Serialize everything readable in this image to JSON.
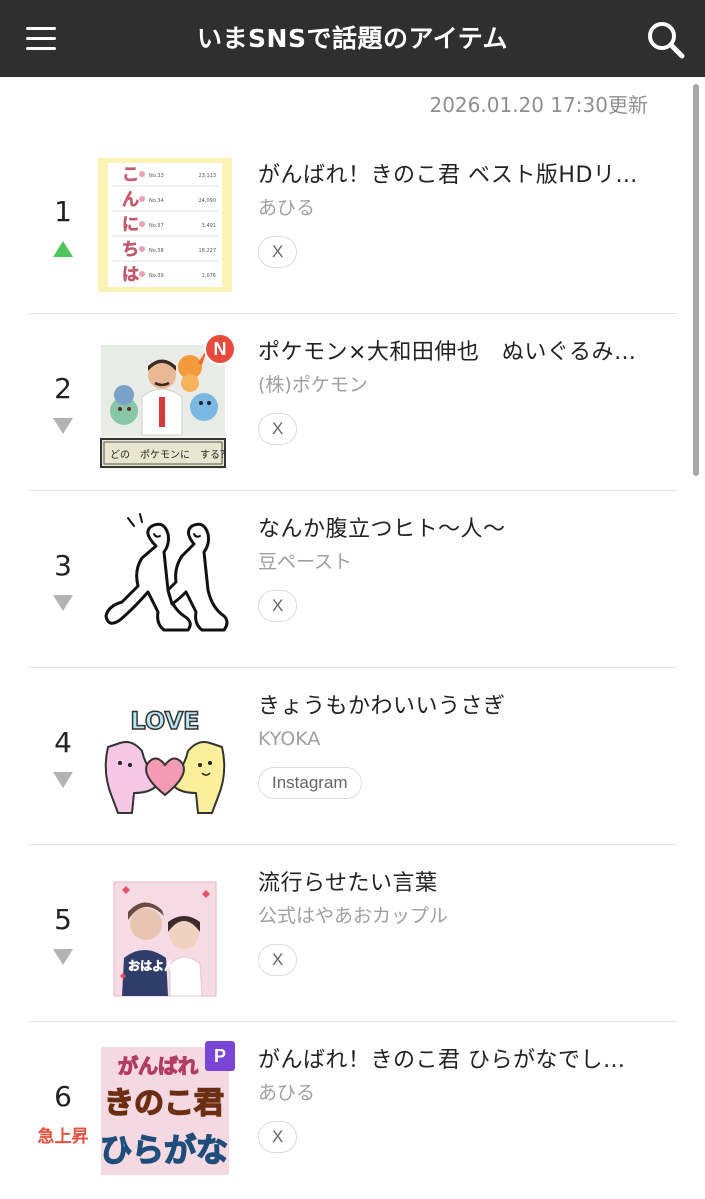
{
  "header": {
    "title": "いまSNSで話題のアイテム",
    "menu_icon": "hamburger-menu-icon",
    "search_icon": "search-icon",
    "background": "#2f2f2f"
  },
  "updated_at": "2026.01.20 17:30更新",
  "items": [
    {
      "rank": "1",
      "trend": "up",
      "trend_label": "",
      "title": "がんばれ！きのこ君 ベスト版HDリ…",
      "author": "あひる",
      "tag": "X",
      "badge": "",
      "thumb": {
        "chars": [
          "こ",
          "ん",
          "に",
          "ち",
          "は"
        ],
        "nos": [
          "No.33",
          "No.34",
          "No.37",
          "No.38",
          "No.39"
        ],
        "vals": [
          "23,113",
          "24,090",
          "3,491",
          "18,227",
          "1,076"
        ]
      }
    },
    {
      "rank": "2",
      "trend": "down",
      "trend_label": "",
      "title": "ポケモン×大和田伸也　ぬいぐるみ…",
      "author": "(株)ポケモン",
      "tag": "X",
      "badge": "N",
      "thumb": {
        "caption": "どの　ポケモンに　する？"
      }
    },
    {
      "rank": "3",
      "trend": "down",
      "trend_label": "",
      "title": "なんか腹立つヒト〜人〜",
      "author": "豆ペースト",
      "tag": "X",
      "badge": ""
    },
    {
      "rank": "4",
      "trend": "down",
      "trend_label": "",
      "title": "きょうもかわいいうさぎ",
      "author": "KYOKA",
      "tag": "Instagram",
      "badge": "",
      "thumb": {
        "word": "LOVE"
      }
    },
    {
      "rank": "5",
      "trend": "down",
      "trend_label": "",
      "title": "流行らせたい言葉",
      "author": "公式はやあおカップル",
      "tag": "X",
      "badge": "",
      "thumb": {
        "caption": "おはよん"
      }
    },
    {
      "rank": "6",
      "trend": "surge",
      "trend_label": "急上昇",
      "title": "がんばれ！きのこ君 ひらがなでし…",
      "author": "あひる",
      "tag": "X",
      "badge": "P",
      "thumb": {
        "line1": "がんばれ",
        "line2": "きのこ君",
        "line3": "ひらがな"
      }
    }
  ]
}
